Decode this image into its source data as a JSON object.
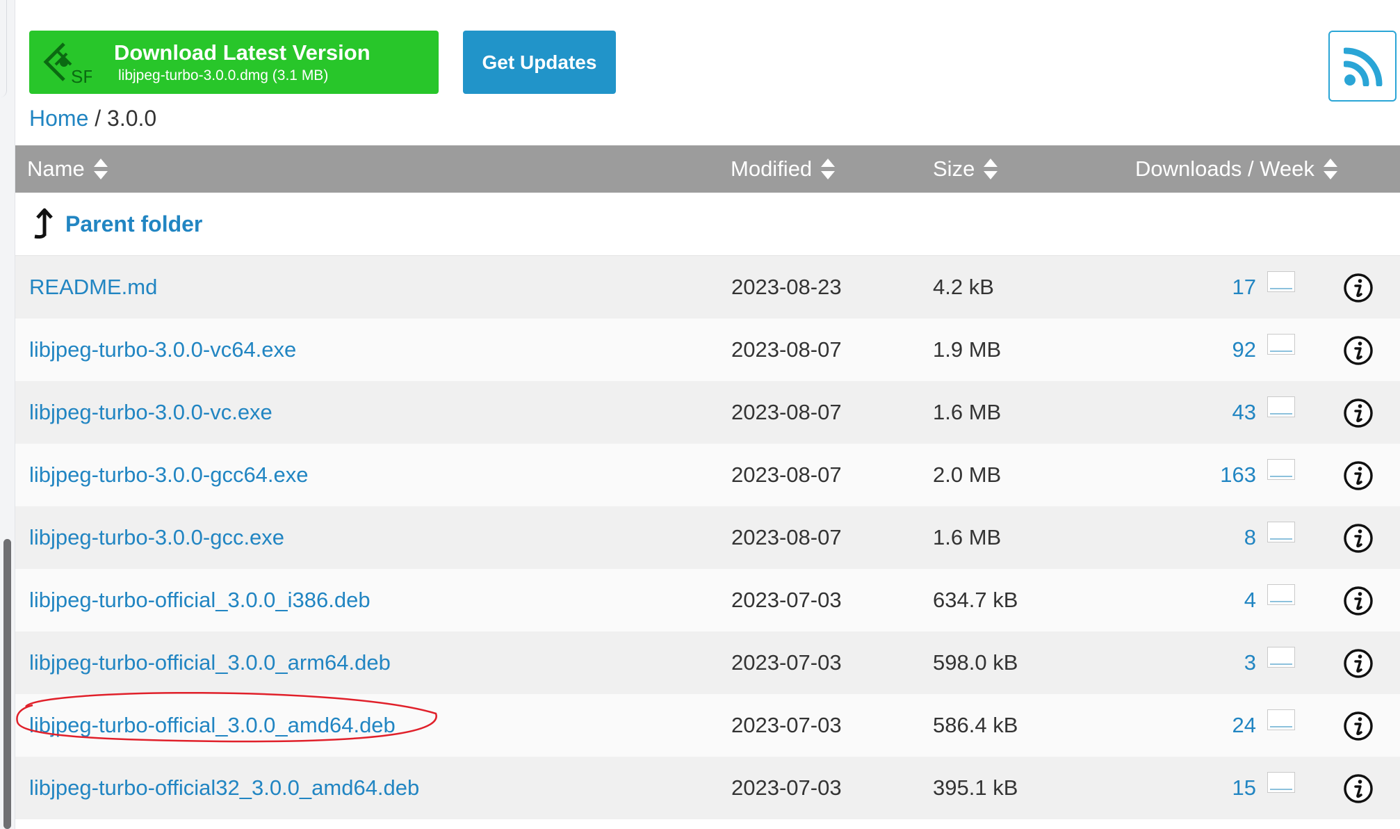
{
  "download_button": {
    "title": "Download Latest Version",
    "subtitle": "libjpeg-turbo-3.0.0.dmg (3.1 MB)",
    "logo_text": "SF"
  },
  "get_updates_label": "Get Updates",
  "breadcrumb": {
    "home": "Home",
    "separator": "/",
    "current": "3.0.0"
  },
  "table": {
    "headers": {
      "name": "Name",
      "modified": "Modified",
      "size": "Size",
      "downloads": "Downloads / Week"
    },
    "parent_folder_label": "Parent folder",
    "rows": [
      {
        "name": "README.md",
        "modified": "2023-08-23",
        "size": "4.2 kB",
        "downloads": "17"
      },
      {
        "name": "libjpeg-turbo-3.0.0-vc64.exe",
        "modified": "2023-08-07",
        "size": "1.9 MB",
        "downloads": "92"
      },
      {
        "name": "libjpeg-turbo-3.0.0-vc.exe",
        "modified": "2023-08-07",
        "size": "1.6 MB",
        "downloads": "43"
      },
      {
        "name": "libjpeg-turbo-3.0.0-gcc64.exe",
        "modified": "2023-08-07",
        "size": "2.0 MB",
        "downloads": "163"
      },
      {
        "name": "libjpeg-turbo-3.0.0-gcc.exe",
        "modified": "2023-08-07",
        "size": "1.6 MB",
        "downloads": "8"
      },
      {
        "name": "libjpeg-turbo-official_3.0.0_i386.deb",
        "modified": "2023-07-03",
        "size": "634.7 kB",
        "downloads": "4"
      },
      {
        "name": "libjpeg-turbo-official_3.0.0_arm64.deb",
        "modified": "2023-07-03",
        "size": "598.0 kB",
        "downloads": "3"
      },
      {
        "name": "libjpeg-turbo-official_3.0.0_amd64.deb",
        "modified": "2023-07-03",
        "size": "586.4 kB",
        "downloads": "24"
      },
      {
        "name": "libjpeg-turbo-official32_3.0.0_amd64.deb",
        "modified": "2023-07-03",
        "size": "395.1 kB",
        "downloads": "15"
      }
    ]
  },
  "icons": {
    "rss": "rss-icon",
    "parent": "arrow-up-icon",
    "info": "info-icon",
    "sort": "sort-icon"
  },
  "colors": {
    "download_green": "#28c62a",
    "updates_blue": "#2194c9",
    "link_blue": "#2185c2",
    "header_gray": "#9c9c9c",
    "annotation_red": "#e0202a"
  }
}
